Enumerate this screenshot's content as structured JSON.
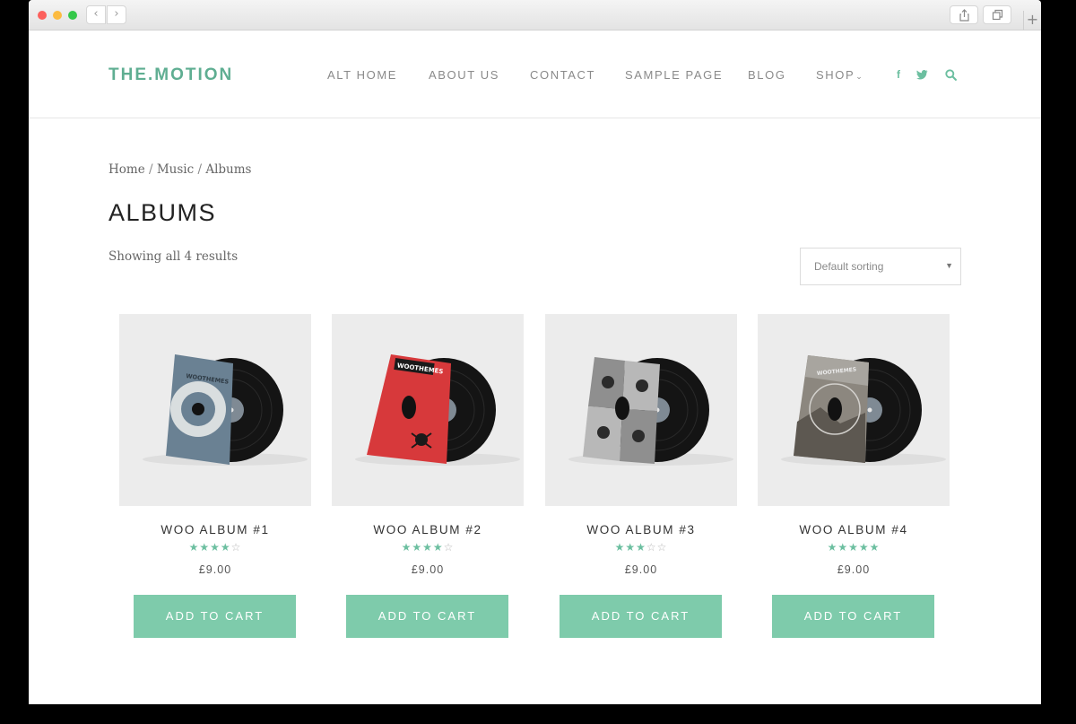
{
  "site": {
    "logo": "THE.MOTION"
  },
  "nav": {
    "items": [
      "ALT HOME",
      "ABOUT US",
      "CONTACT",
      "SAMPLE PAGE",
      "BLOG",
      "SHOP"
    ],
    "social": [
      "f",
      "t"
    ]
  },
  "breadcrumb": {
    "items": [
      "Home",
      "Music",
      "Albums"
    ],
    "separator": "/"
  },
  "page": {
    "title": "ALBUMS",
    "result_count": "Showing all 4 results"
  },
  "sort": {
    "selected": "Default sorting"
  },
  "products": [
    {
      "title": "WOO ALBUM #1",
      "rating": 4,
      "price": "£9.00",
      "button": "ADD TO CART"
    },
    {
      "title": "WOO ALBUM #2",
      "rating": 4,
      "price": "£9.00",
      "button": "ADD TO CART"
    },
    {
      "title": "WOO ALBUM #3",
      "rating": 3,
      "price": "£9.00",
      "button": "ADD TO CART"
    },
    {
      "title": "WOO ALBUM #4",
      "rating": 5,
      "price": "£9.00",
      "button": "ADD TO CART"
    }
  ],
  "album_art": [
    "WOOTHEMES",
    "WOOTHEMES",
    "",
    "WOOTHEMES"
  ],
  "colors": {
    "brand": "#5fae92",
    "button": "#7ecbab",
    "star_on": "#6cbfa0",
    "star_off": "#b6b6b6"
  },
  "icons": [
    "share-icon",
    "tabs-icon",
    "facebook-icon",
    "twitter-icon",
    "search-icon",
    "chevron-down-icon",
    "vinyl-record-image"
  ]
}
